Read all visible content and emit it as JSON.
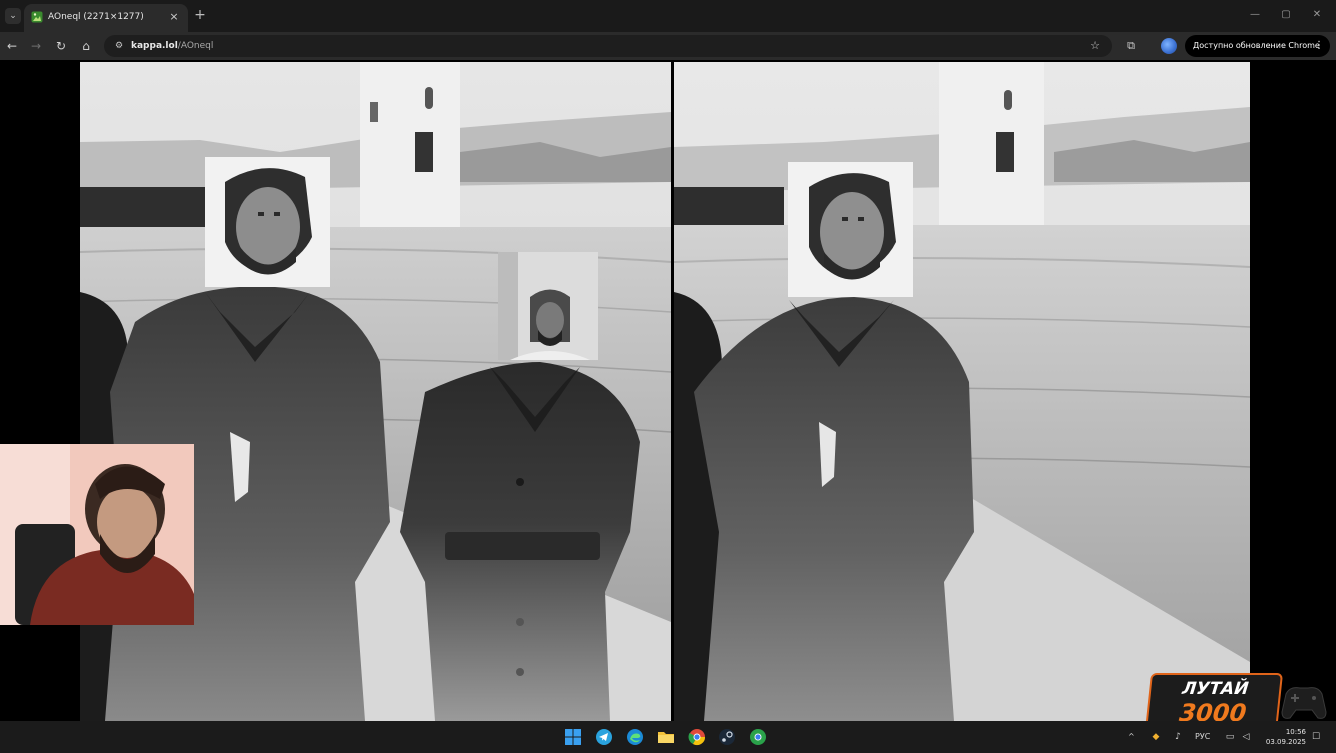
{
  "browser": {
    "tab": {
      "title": "AOneql (2271×1277)",
      "favicon": "image-file-icon",
      "close_glyph": "×"
    },
    "new_tab_glyph": "+",
    "window_controls": [
      "—",
      "▢",
      "✕"
    ],
    "nav": {
      "back": "←",
      "forward": "→",
      "reload": "↻",
      "home": "⌂"
    },
    "address_bar": {
      "host": "kappa.lol",
      "path": "/AOneql",
      "site_info_glyph": "⚙"
    },
    "bookmark_glyph": "☆",
    "extensions_glyph": "⧉",
    "update_notice": "Доступно обновление Chrome",
    "menu_glyph": "⋮"
  },
  "content": {
    "left_photo": "edited photo with pasted faces",
    "right_photo": "original photo"
  },
  "stream_overlay": {
    "logo_line1": "ЛУТАЙ",
    "logo_line2": "3000",
    "accent": "#f07a1e"
  },
  "taskbar": {
    "apps": [
      "windows-start-icon",
      "telegram-icon",
      "edge-icon",
      "file-explorer-icon",
      "chrome-icon",
      "steam-icon",
      "chrome-alt-icon"
    ],
    "tray": {
      "chevron": "^",
      "language": "РУС",
      "time": "10:56",
      "date": "03.09.2025"
    }
  }
}
